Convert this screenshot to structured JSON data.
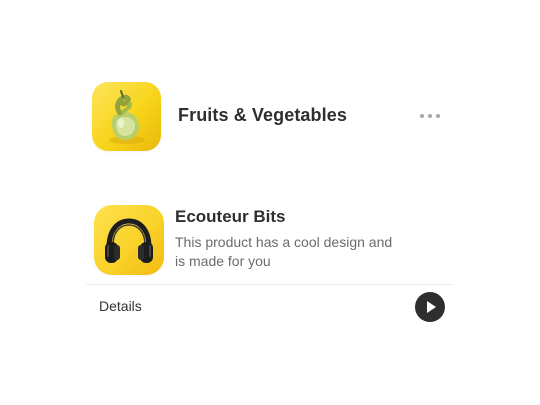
{
  "cards": [
    {
      "title": "Fruits & Vegetables",
      "icon": "pear-fruit-icon",
      "more_icon": "more-horizontal-icon"
    },
    {
      "title": "Ecouteur Bits",
      "description": "This product has a cool design and is made for you",
      "icon": "headphones-icon",
      "details_label": "Details",
      "action_icon": "play-icon"
    }
  ],
  "colors": {
    "accent_yellow": "#f7d41a",
    "title_text": "#2f2f2f",
    "secondary_text": "#6b6b6b",
    "play_button": "#2e2e2e",
    "more_dots": "#a9a9a9"
  }
}
